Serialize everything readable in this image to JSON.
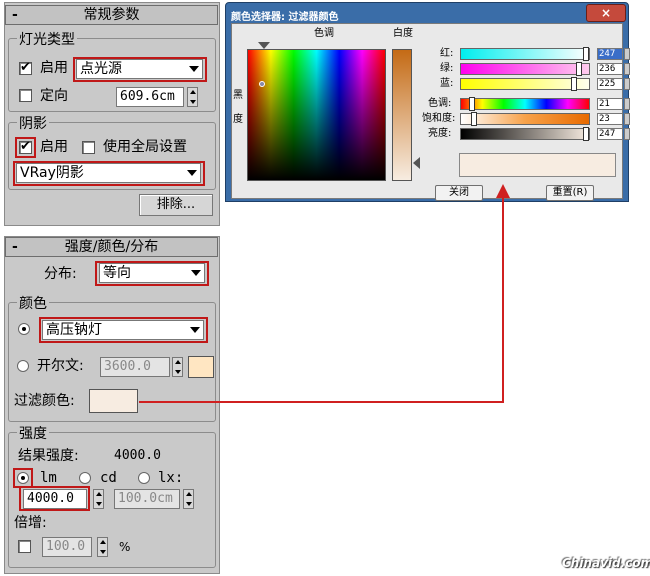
{
  "general": {
    "title": "常规参数",
    "light_type_group": "灯光类型",
    "enable_label": "启用",
    "light_type_value": "点光源",
    "targeted_label": "定向",
    "target_distance": "609.6cm",
    "shadows_group": "阴影",
    "shadow_enable_label": "启用",
    "use_global_label": "使用全局设置",
    "shadow_type_value": "VRay阴影",
    "exclude_label": "排除..."
  },
  "intensity": {
    "title": "强度/颜色/分布",
    "distribution_label": "分布:",
    "distribution_value": "等向",
    "color_group": "颜色",
    "color_preset_value": "高压钠灯",
    "kelvin_label": "开尔文:",
    "kelvin_value": "3600.0",
    "filter_color_label": "过滤颜色:",
    "intensity_group": "强度",
    "resulting_label": "结果强度:",
    "resulting_value": "4000.0",
    "unit_lm": "lm",
    "unit_cd": "cd",
    "unit_lx": "lx:",
    "intensity_value": "4000.0",
    "distance_value": "100.0cm",
    "multiplier_label": "倍增:",
    "multiplier_value": "100.0",
    "percent": "%"
  },
  "color_picker": {
    "title": "颜色选择器: 过滤器颜色",
    "close_icon": "×",
    "hue_label": "色调",
    "whiteness_label": "白度",
    "blackness_label": "黑度",
    "red_label": "红:",
    "green_label": "绿:",
    "blue_label": "蓝:",
    "hue_row_label": "色调:",
    "sat_label": "饱和度:",
    "value_label": "亮度:",
    "red": "247",
    "green": "236",
    "blue": "225",
    "hue": "21",
    "saturation": "23",
    "brightness": "247",
    "close_button": "关闭",
    "reset_button": "重置(R)"
  },
  "watermark": "Chinavid.com",
  "colors": {
    "filter_swatch": "#f7ece1",
    "kelvin_swatch": "#ffe6c2",
    "highlight_red": "#c01818",
    "connector": "#d02020"
  }
}
